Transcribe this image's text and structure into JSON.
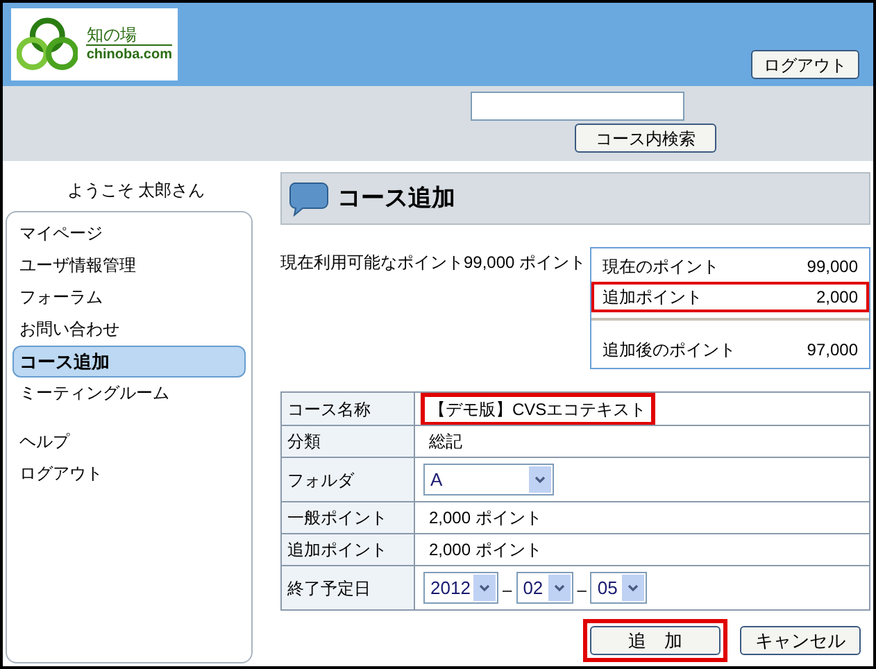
{
  "header": {
    "logo": {
      "title": "知の場",
      "subtitle": "chinoba.com"
    },
    "logout_button": "ログアウト",
    "search_button": "コース内検索"
  },
  "sidebar": {
    "welcome": "ようこそ 太郎さん",
    "sections": [
      {
        "items": [
          {
            "label": "マイページ",
            "selected": false
          },
          {
            "label": "ユーザ情報管理",
            "selected": false
          },
          {
            "label": "フォーラム",
            "selected": false
          },
          {
            "label": "お問い合わせ",
            "selected": false
          },
          {
            "label": "コース追加",
            "selected": true
          },
          {
            "label": "ミーティングルーム",
            "selected": false
          }
        ]
      },
      {
        "items": [
          {
            "label": "ヘルプ",
            "selected": false
          },
          {
            "label": "ログアウト",
            "selected": false
          }
        ]
      }
    ]
  },
  "page_title": "コース追加",
  "available_points": "現在利用可能なポイント99,000 ポイント",
  "points_summary": [
    {
      "kind": "line",
      "label": "現在のポイント",
      "value": "99,000",
      "highlighted": false
    },
    {
      "kind": "line",
      "label": "追加ポイント",
      "value": "2,000",
      "highlighted": true
    },
    {
      "kind": "total",
      "label": "追加後のポイント",
      "value": "97,000",
      "highlighted": false
    }
  ],
  "form": {
    "rows": [
      {
        "kind": "text",
        "label": "コース名称",
        "value": "【デモ版】CVSエコテキスト",
        "highlighted": true
      },
      {
        "kind": "text",
        "label": "分類",
        "value": "総記",
        "highlighted": false
      },
      {
        "kind": "select",
        "label": "フォルダ",
        "value": "A"
      },
      {
        "kind": "text",
        "label": "一般ポイント",
        "value": "2,000 ポイント",
        "highlighted": false
      },
      {
        "kind": "text",
        "label": "追加ポイント",
        "value": "2,000 ポイント",
        "highlighted": false
      },
      {
        "kind": "date",
        "label": "終了予定日",
        "parts": [
          "2012",
          "02",
          "05"
        ],
        "separator": "–"
      }
    ]
  },
  "buttons": [
    {
      "label": "追　加",
      "highlighted": true
    },
    {
      "label": "キャンセル",
      "highlighted": false
    }
  ]
}
